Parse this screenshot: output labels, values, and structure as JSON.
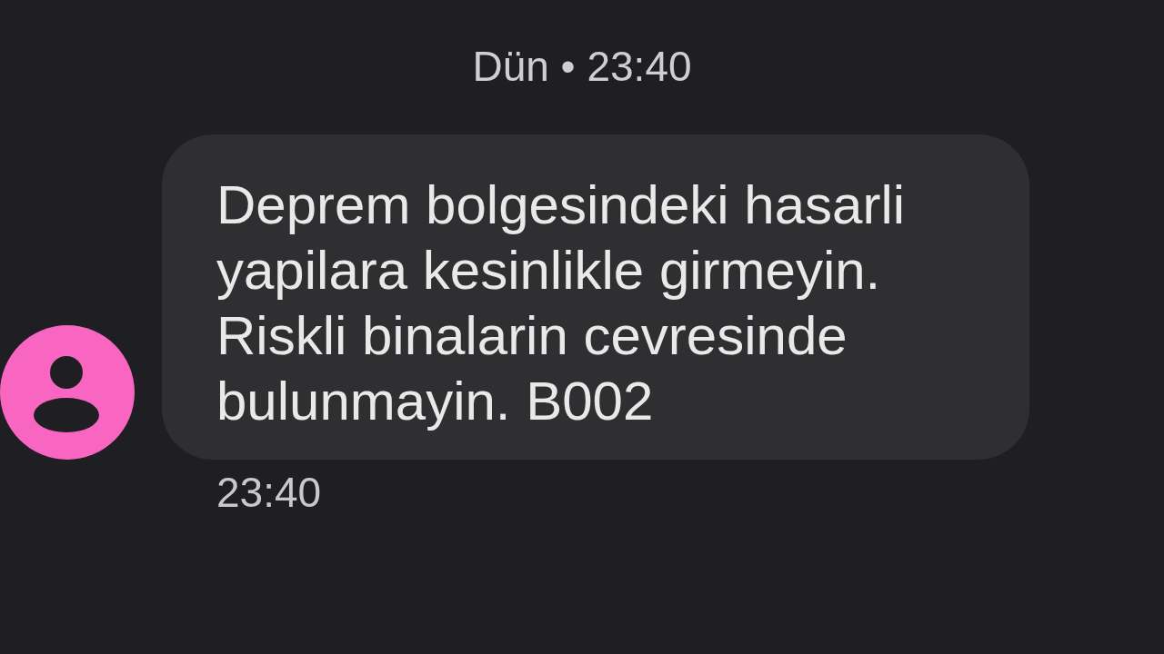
{
  "conversation": {
    "date_header": "Dün • 23:40",
    "messages": [
      {
        "kind": "received",
        "text": "Deprem bolgesindeki hasarli yapilara kesinlikle girmeyin. Riskli binalarin cevresinde bulunmayin. B002",
        "time": "23:40"
      }
    ]
  }
}
